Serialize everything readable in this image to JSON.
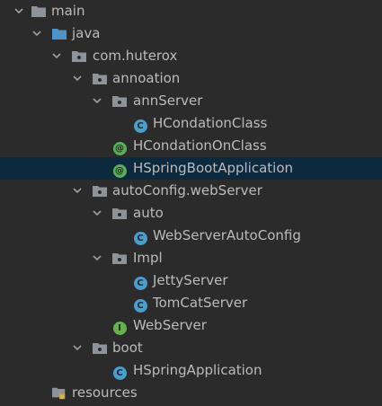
{
  "colors": {
    "background": "#2b2b2b",
    "selection": "#0d293e",
    "text": "#bbbbbb",
    "folder": "#8d939a",
    "source_folder": "#4f94c9",
    "class_badge": "#4a9ec9",
    "annotation_badge": "#5cad5a",
    "interface_badge": "#66b04d"
  },
  "tree": [
    {
      "label": "main",
      "type": "folder",
      "expanded": true
    },
    {
      "label": "java",
      "type": "source-folder",
      "expanded": true
    },
    {
      "label": "com.huterox",
      "type": "package",
      "expanded": true
    },
    {
      "label": "annoation",
      "type": "package",
      "expanded": true
    },
    {
      "label": "annServer",
      "type": "package",
      "expanded": true
    },
    {
      "label": "HCondationClass",
      "type": "class",
      "badge": "C"
    },
    {
      "label": "HCondationOnClass",
      "type": "annotation",
      "badge": "@"
    },
    {
      "label": "HSpringBootApplication",
      "type": "annotation",
      "badge": "@",
      "selected": true
    },
    {
      "label": "autoConfig.webServer",
      "type": "package",
      "expanded": true
    },
    {
      "label": "auto",
      "type": "package",
      "expanded": true
    },
    {
      "label": "WebServerAutoConfig",
      "type": "class",
      "badge": "C"
    },
    {
      "label": "Impl",
      "type": "package",
      "expanded": true
    },
    {
      "label": "JettyServer",
      "type": "class",
      "badge": "C"
    },
    {
      "label": "TomCatServer",
      "type": "class",
      "badge": "C"
    },
    {
      "label": "WebServer",
      "type": "interface",
      "badge": "I"
    },
    {
      "label": "boot",
      "type": "package",
      "expanded": true
    },
    {
      "label": "HSpringApplication",
      "type": "class",
      "badge": "C"
    },
    {
      "label": "resources",
      "type": "resources-folder",
      "expanded": false
    }
  ]
}
